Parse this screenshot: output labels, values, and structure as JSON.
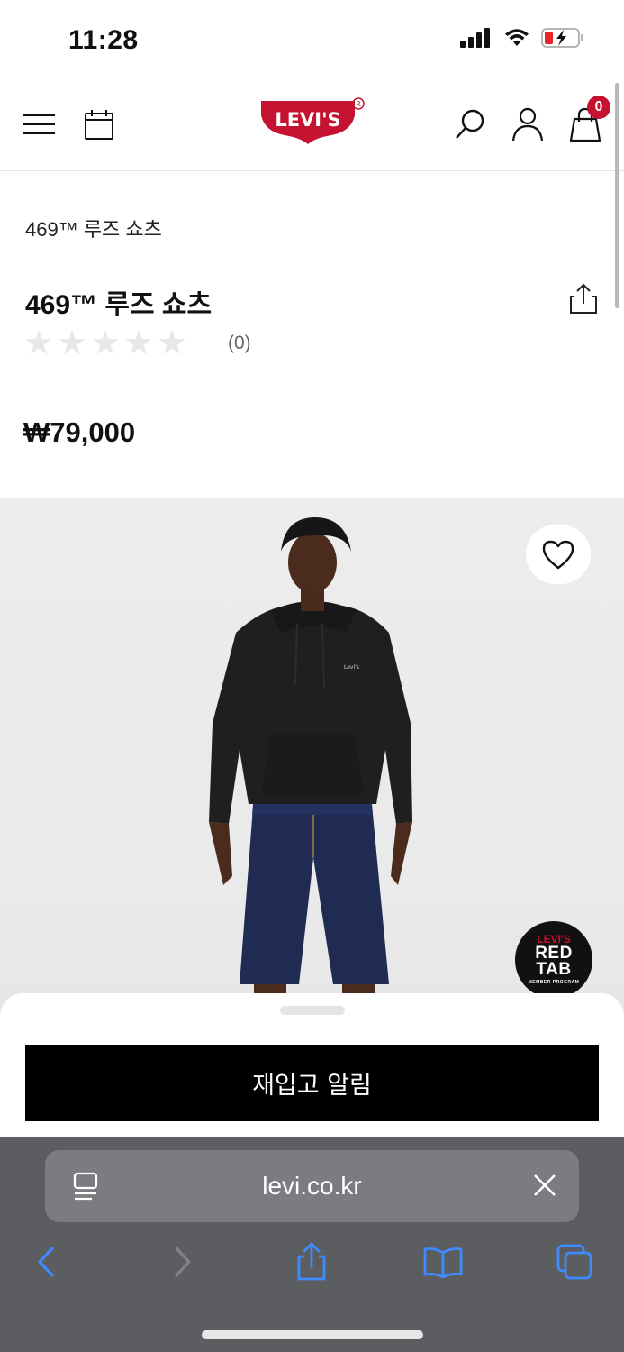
{
  "status": {
    "time": "11:28"
  },
  "header": {
    "brand": "Levi's",
    "cart_count": "0"
  },
  "product": {
    "breadcrumb": "469™ 루즈 쇼츠",
    "title": "469™ 루즈 쇼츠",
    "rating_count": "(0)",
    "rating_stars": 0,
    "price": "₩79,000",
    "badge": {
      "brand": "LEVI'S",
      "line1": "RED",
      "line2": "TAB",
      "small": "MEMBER PROGRAM"
    }
  },
  "actions": {
    "notify_label": "재입고 알림"
  },
  "browser": {
    "url": "levi.co.kr"
  },
  "colors": {
    "brand_red": "#c41230",
    "ios_blue": "#3d8bff"
  },
  "icons": [
    "menu-icon",
    "calendar-icon",
    "search-icon",
    "user-icon",
    "bag-icon",
    "share-icon",
    "heart-icon",
    "reader-icon",
    "close-icon",
    "back-icon",
    "forward-icon",
    "share-sheet-icon",
    "bookmarks-icon",
    "tabs-icon"
  ]
}
